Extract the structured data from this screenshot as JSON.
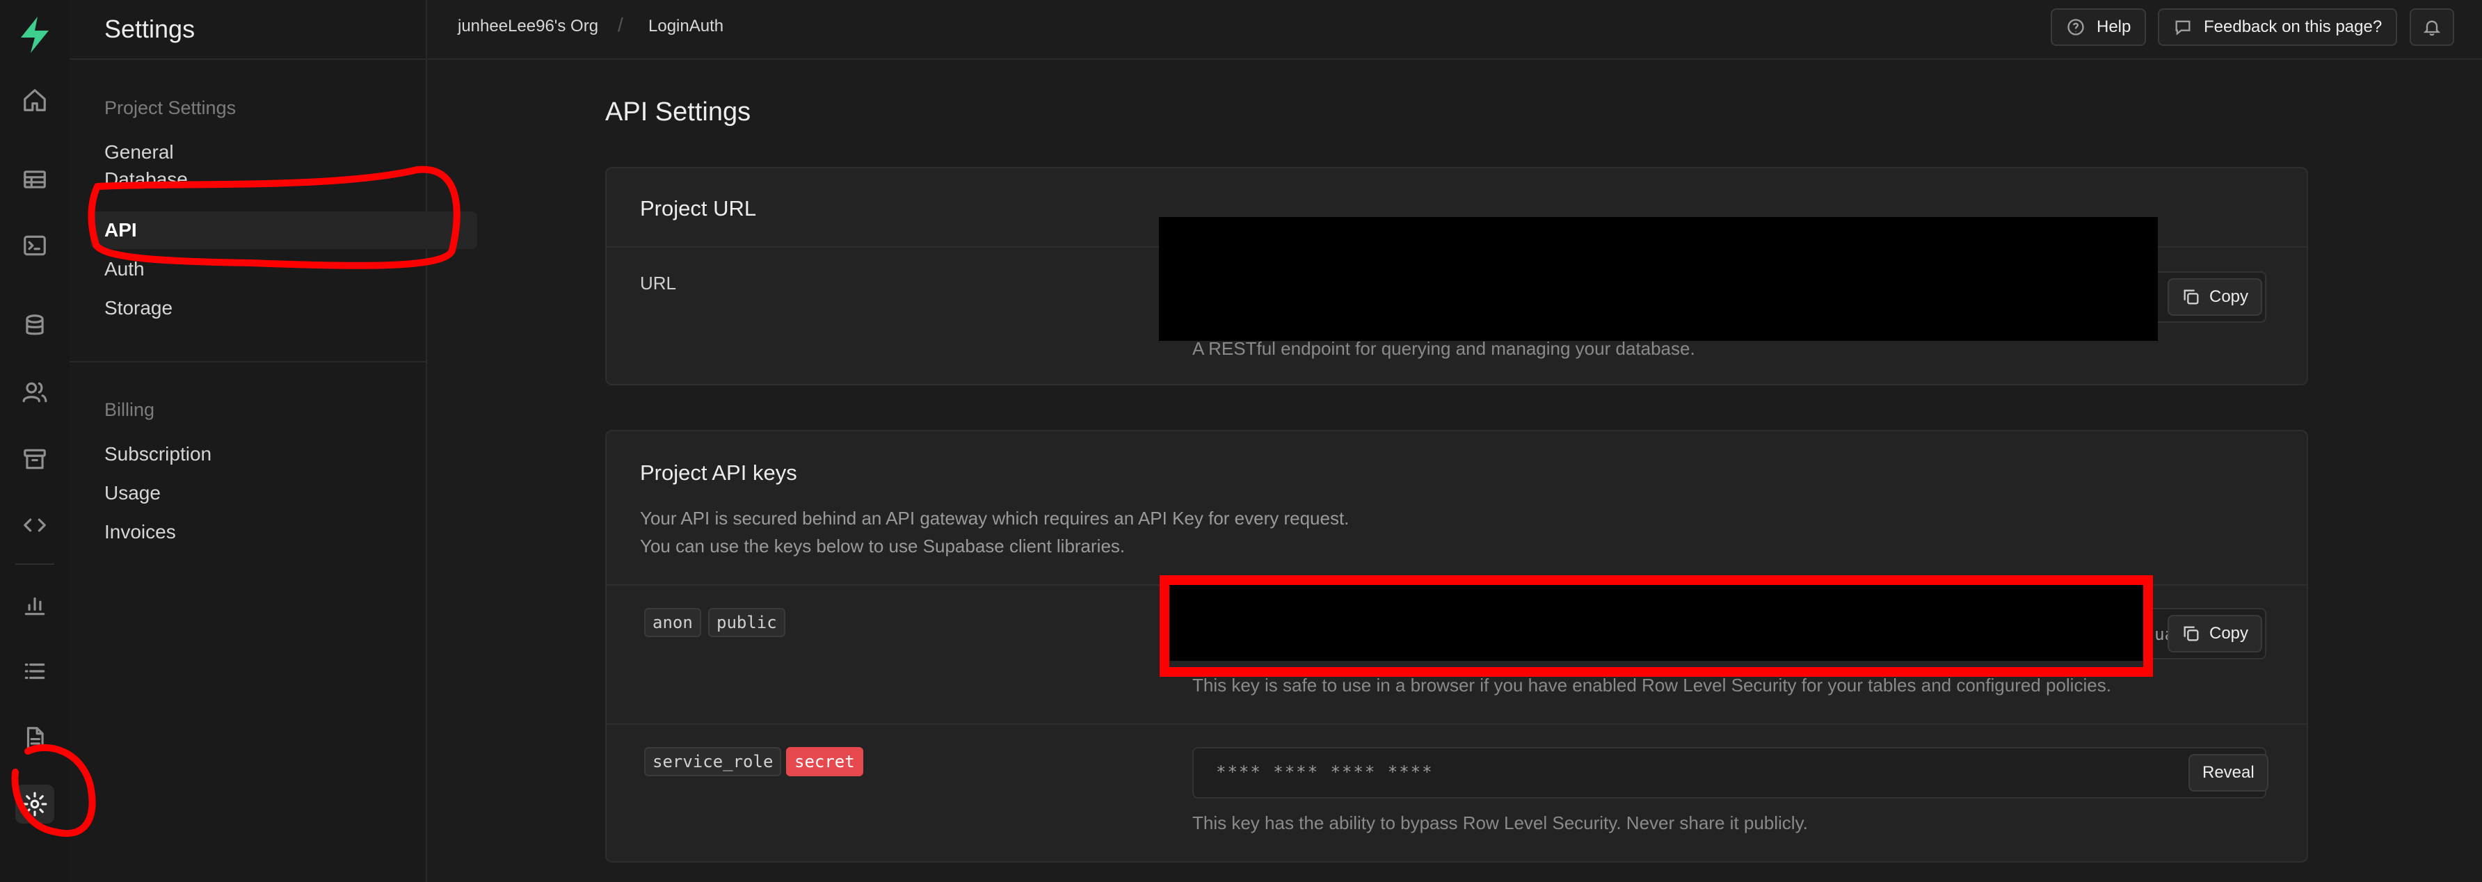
{
  "app": {
    "rail_icons": [
      "lightning-logo-icon",
      "home-icon",
      "table-editor-icon",
      "sql-editor-icon",
      "database-icon",
      "users-icon",
      "storage-icon",
      "api-code-icon",
      "reports-icon",
      "logs-icon",
      "docs-icon",
      "settings-icon"
    ]
  },
  "sidenav": {
    "title": "Settings",
    "project_group": "Project Settings",
    "project_items": [
      "General",
      "Database",
      "API",
      "Auth",
      "Storage"
    ],
    "active_item": "API",
    "billing_group": "Billing",
    "billing_items": [
      "Subscription",
      "Usage",
      "Invoices"
    ]
  },
  "topbar": {
    "org": "junheeLee96's Org",
    "separator": "/",
    "project": "LoginAuth",
    "help_label": "Help",
    "feedback_label": "Feedback on this page?"
  },
  "main": {
    "title": "API Settings",
    "project_url": {
      "title": "Project URL",
      "field_label": "URL",
      "copy_label": "Copy",
      "description": "A RESTful endpoint for querying and managing your database."
    },
    "api_keys": {
      "title": "Project API keys",
      "intro_line1": "Your API is secured behind an API gateway which requires an API Key for every request.",
      "intro_line2": "You can use the keys below to use Supabase client libraries.",
      "anon": {
        "tag1": "anon",
        "tag2": "public",
        "copy_label": "Copy",
        "partial_visible": "ua",
        "description": "This key is safe to use in a browser if you have enabled Row Level Security for your tables and configured policies."
      },
      "service_role": {
        "tag1": "service_role",
        "tag2": "secret",
        "masked_value": "**** **** **** ****",
        "reveal_label": "Reveal",
        "description": "This key has the ability to bypass Row Level Security. Never share it publicly."
      }
    }
  },
  "colors": {
    "brand_green": "#3ecf8e",
    "secret_red": "#e5484d",
    "annotation_red": "#ff0000"
  }
}
